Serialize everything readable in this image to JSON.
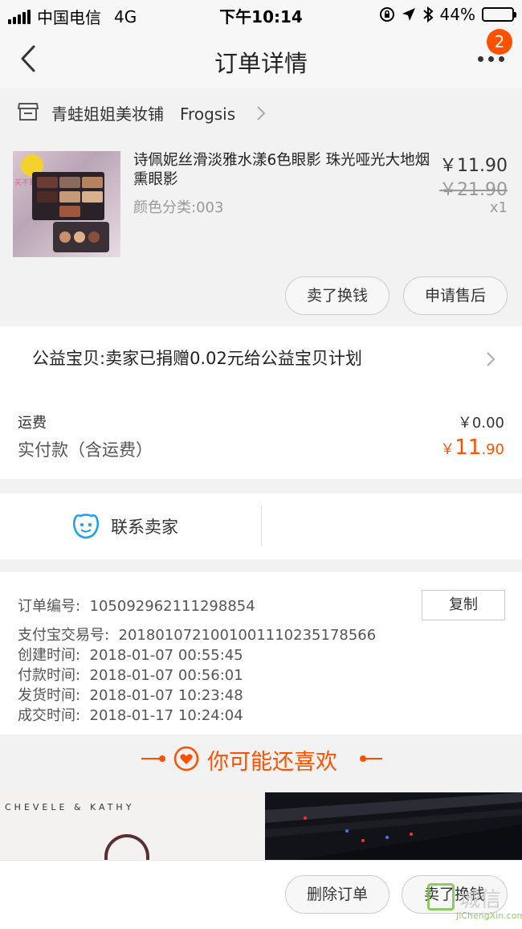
{
  "status_bar": {
    "carrier": "中国电信",
    "network": "4G",
    "time": "下午10:14",
    "battery_percent": "44%",
    "battery_level": 0.44
  },
  "nav": {
    "title": "订单详情",
    "badge_count": "2"
  },
  "shop": {
    "name": "青蛙姐姐美妆铺　Frogsis"
  },
  "product": {
    "title": "诗佩妮丝滑淡雅水漾6色眼影 珠光哑光大地烟熏眼影",
    "spec": "颜色分类:003",
    "price": "￥11.90",
    "original_price": "￥21.90",
    "quantity": "x1",
    "thumb_caption": "买不到香奶奶268嘛",
    "actions": [
      "卖了换钱",
      "申请售后"
    ]
  },
  "charity": {
    "text": "公益宝贝:卖家已捐赠0.02元给公益宝贝计划"
  },
  "fees": {
    "shipping_label": "运费",
    "shipping_value": "￥0.00",
    "paid_label": "实付款（含运费）",
    "paid_currency": "￥",
    "paid_int": "11",
    "paid_dec": ".90"
  },
  "contact": {
    "label": "联系卖家"
  },
  "order_info": {
    "order_no_label": "订单编号:",
    "order_no": "105092962111298854",
    "copy_label": "复制",
    "rows": [
      {
        "label": "支付宝交易号:",
        "value": "2018010721001001110235178566"
      },
      {
        "label": "创建时间:",
        "value": "2018-01-07 00:55:45"
      },
      {
        "label": "付款时间:",
        "value": "2018-01-07 00:56:01"
      },
      {
        "label": "发货时间:",
        "value": "2018-01-07 10:23:48"
      },
      {
        "label": "成交时间:",
        "value": "2018-01-17 10:24:04"
      }
    ]
  },
  "recommend": {
    "title": "你可能还喜欢",
    "brand_left": "CHEVELE & KATHY"
  },
  "bottom_bar": {
    "delete_label": "删除订单",
    "sell_label": "卖了换钱"
  },
  "watermark": {
    "text": "城信",
    "domain": "JiChengXin.com"
  },
  "colors": {
    "accent": "#ff5000",
    "background": "#f2f2f2",
    "contact_icon": "#1aa0f0"
  }
}
